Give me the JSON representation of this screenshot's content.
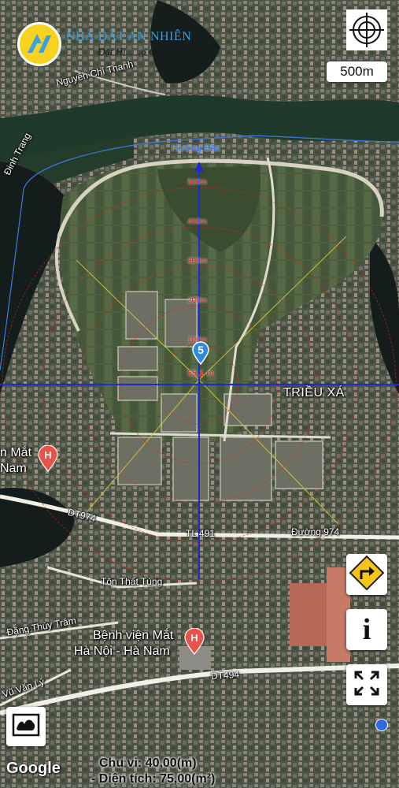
{
  "brand": {
    "name": "NHÀ ĐẤT AN NHIÊN",
    "tagline": "Đặt Hi... ..ọ Cả"
  },
  "scale": {
    "label": "500m"
  },
  "compass": {
    "icon": "crosshair-compass-icon"
  },
  "overlay": {
    "north_label": "Hướng Bắc",
    "ring_labels": [
      "500m",
      "400m",
      "300m",
      "200m",
      "100m"
    ],
    "center_marker": "5",
    "center_distance": "55.1 m",
    "line_color": "#1d2bd6",
    "ring_color": "#e0231b"
  },
  "places": {
    "road_nguyen_chi_thanh": "Nguyễn Chí Thanh",
    "road_dinh_trang": "Đinh Trang",
    "area_trieu_xa": "TRIỀU XÁ",
    "hospital_left_line1": "n Mắt",
    "hospital_left_line2": "Nam",
    "road_dt974": "DT974",
    "road_tl491": "TL 491",
    "road_duong_974": "Đường 974",
    "road_ton_that_tung": "Tôn Thất Tùng",
    "road_dang_thuy_tram": "Đặng Thùy Trâm",
    "hospital_main_line1": "Bệnh viện Mắt",
    "hospital_main_line2": "Hà Nội - Hà Nam",
    "road_dt494": "DT494",
    "road_vu_van_ly": "Vũ Văn Lý"
  },
  "controls": {
    "directions_icon": "turn-right-sign-icon",
    "info_icon": "info-icon",
    "fullscreen_icon": "fullscreen-icon",
    "maptype_icon": "map-layer-icon"
  },
  "attribution": "Google",
  "measurements": {
    "perimeter": "Chu vi: 40,00(m)",
    "area": "- Diện tích: 75,00(m²)"
  }
}
